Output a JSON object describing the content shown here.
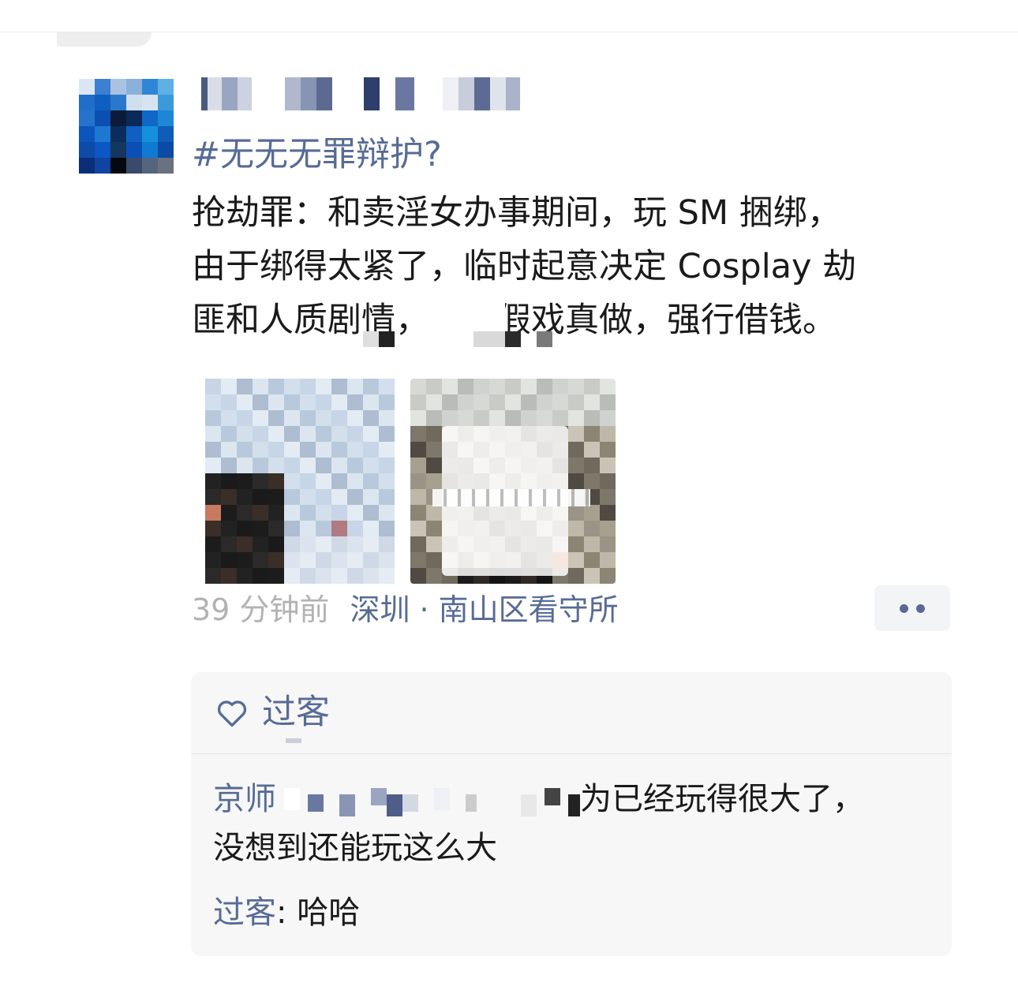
{
  "post": {
    "topic": "#无无无罪辩护?",
    "content_lines": [
      "抢劫罪：和卖淫女办事期间，玩 SM 捆绑，",
      "由于绑得太紧了，临时起意决定 Cosplay 劫",
      "匪和人质剧情，最后假戏真做，强行借钱。"
    ],
    "time": "39 分钟前",
    "location": "深圳 · 南山区看守所",
    "photo_count": 2
  },
  "actions": {
    "more_icon": "more-dots-icon"
  },
  "likes": {
    "icon": "heart-outline-icon",
    "names": [
      "过客"
    ]
  },
  "comments": [
    {
      "author": "京师",
      "text_line1": "为已经玩得很大了，",
      "text_line2": "没想到还能玩这么大"
    },
    {
      "author": "过客",
      "separator": ": ",
      "text": "哈哈"
    }
  ],
  "colors": {
    "link": "#576b95",
    "text": "#1a1a1a",
    "muted": "#b2b2b2",
    "comment_bg": "#f7f7f7",
    "more_bg": "#f3f4f6"
  }
}
